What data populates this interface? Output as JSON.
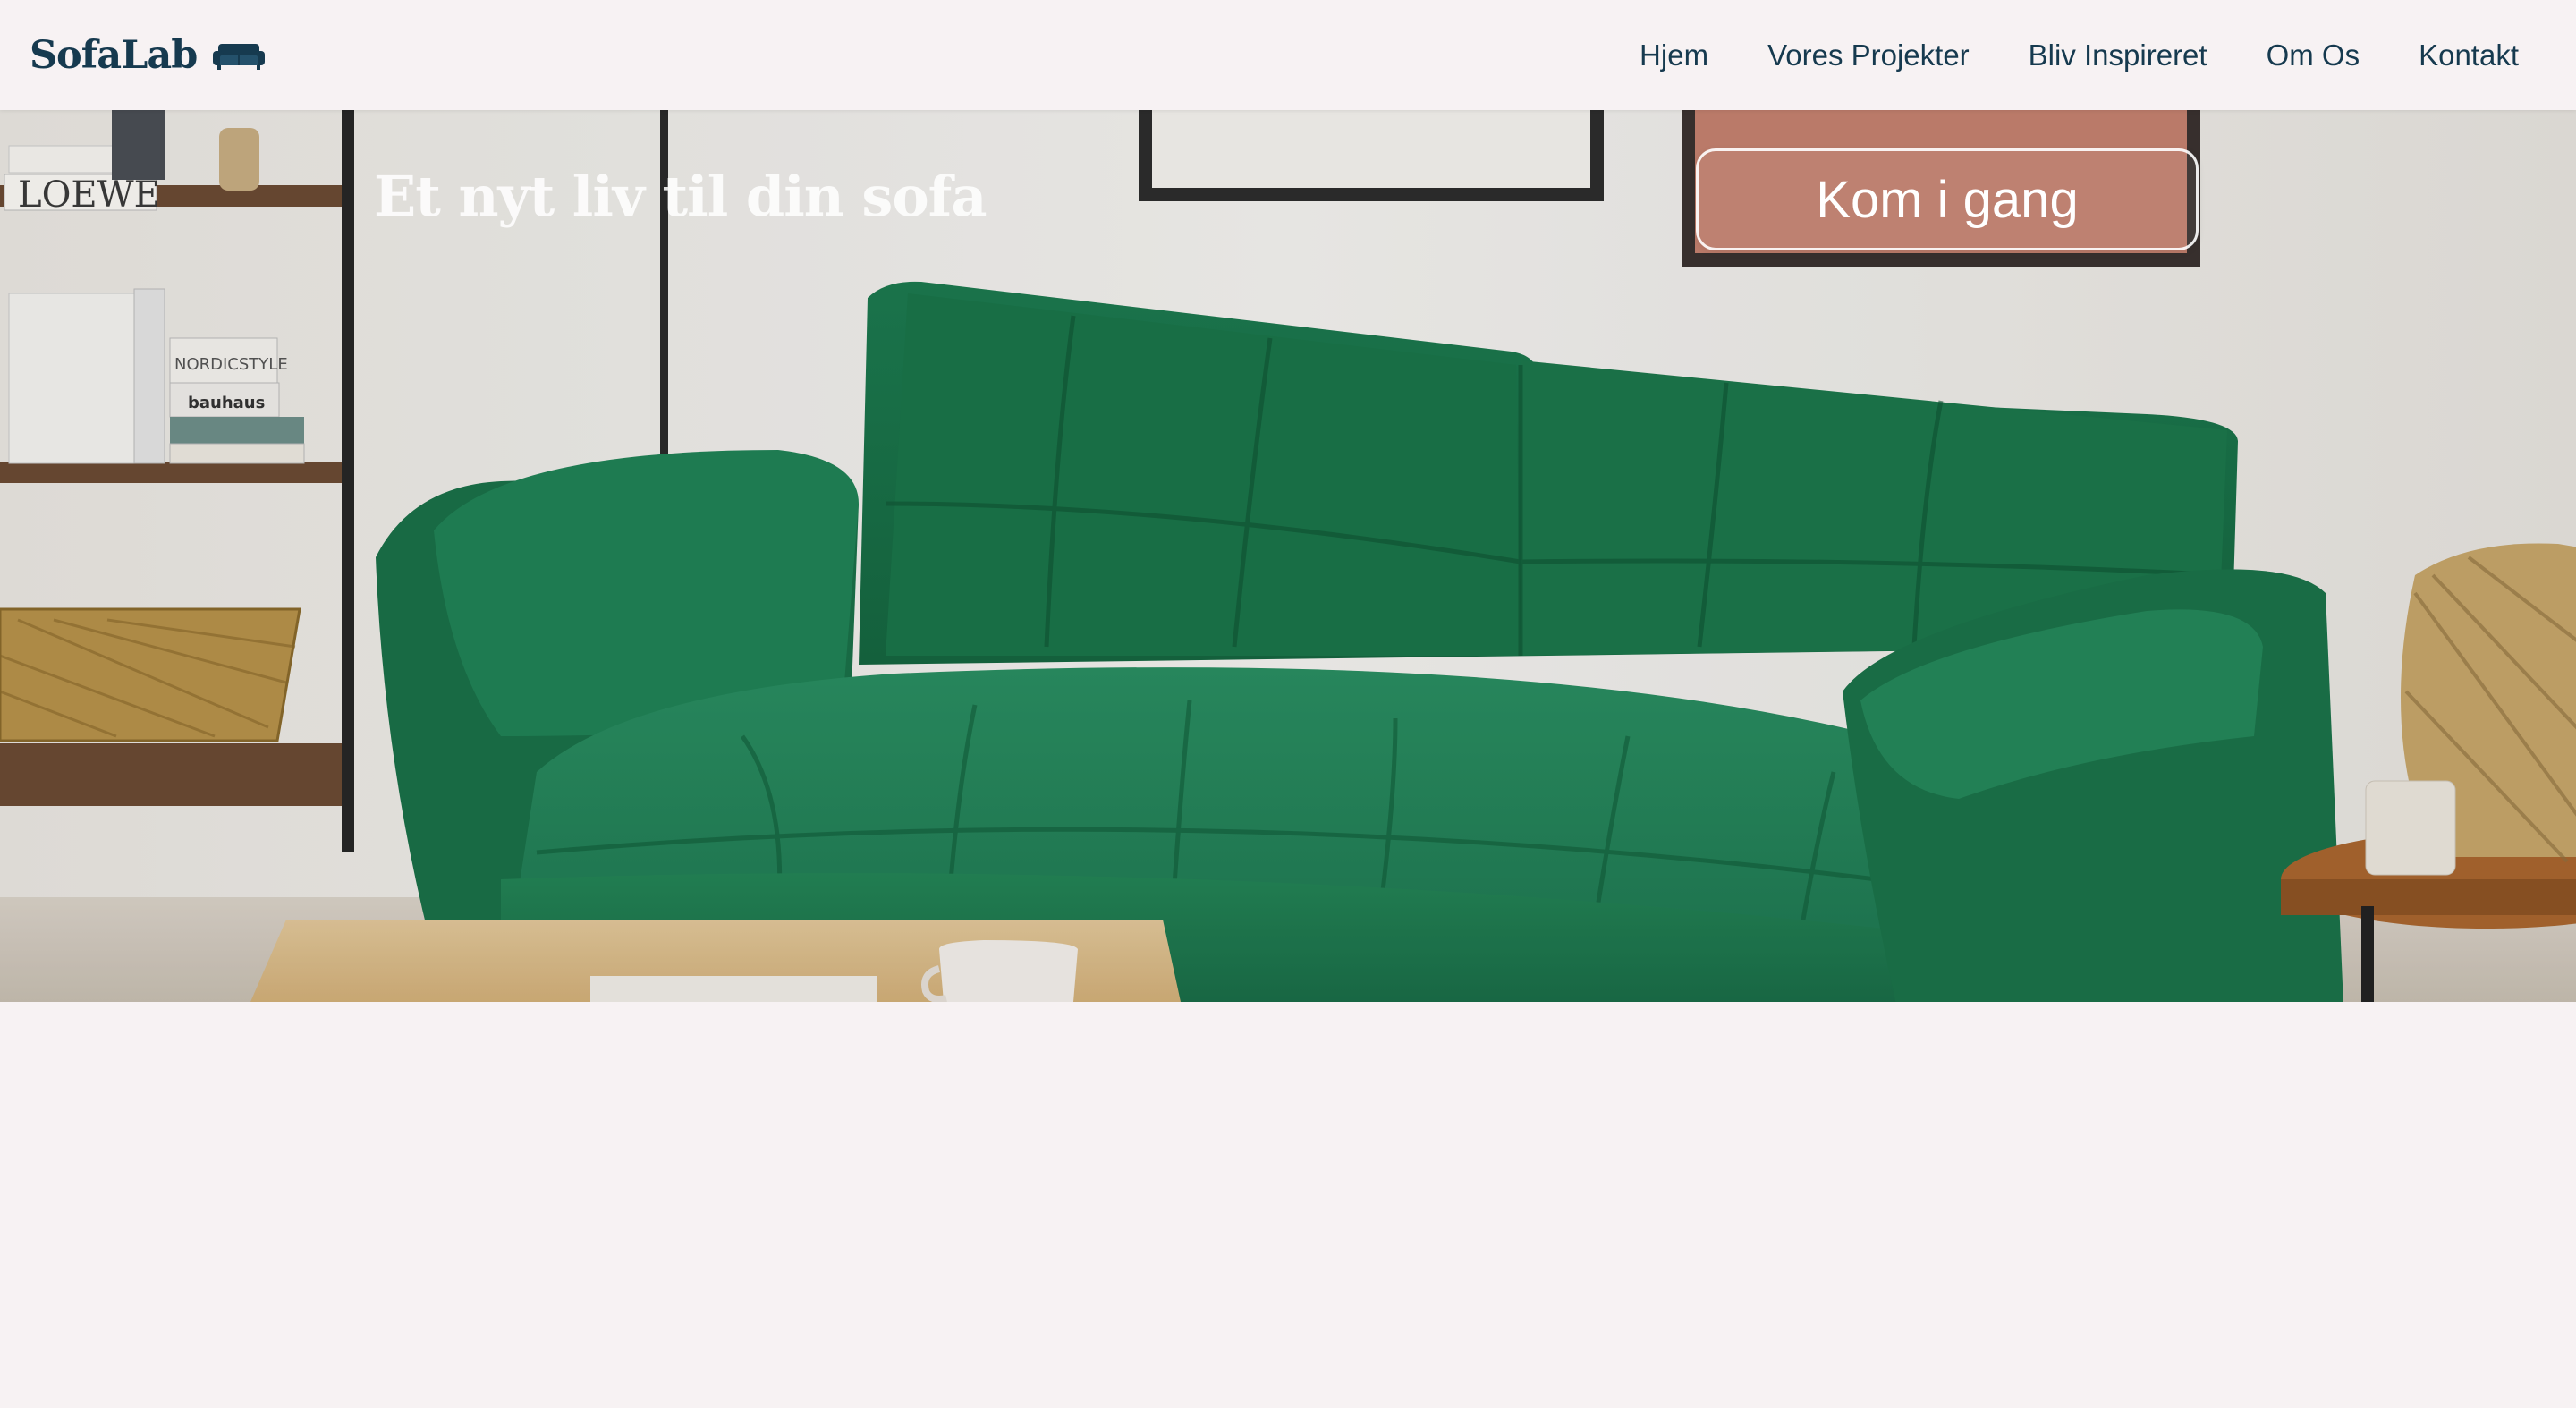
{
  "brand": {
    "name": "SofaLab",
    "icon": "sofa-icon",
    "color": "#163a4f"
  },
  "nav": {
    "links": [
      {
        "label": "Hjem"
      },
      {
        "label": "Vores Projekter"
      },
      {
        "label": "Bliv Inspireret"
      },
      {
        "label": "Om Os"
      },
      {
        "label": "Kontakt"
      }
    ]
  },
  "hero": {
    "title": "Et nyt liv til din sofa",
    "cta_label": "Kom i gang",
    "image": "green-velvet-sofa-living-room"
  },
  "colors": {
    "background": "#f7f2f3",
    "text": "#163a4f",
    "sofa_green": "#1f7a52"
  }
}
